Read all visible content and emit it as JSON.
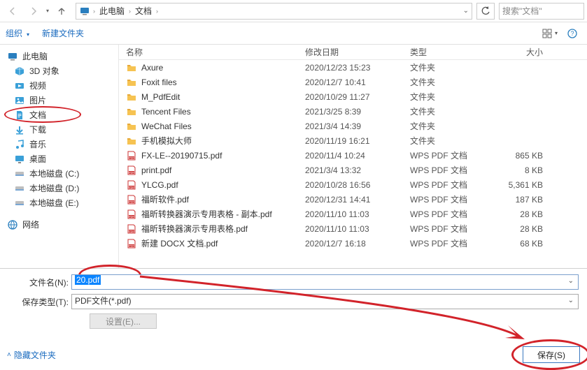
{
  "nav": {
    "back_icon": "←",
    "fwd_icon": "→"
  },
  "breadcrumb": {
    "root": "此电脑",
    "folder": "文档"
  },
  "search": {
    "placeholder": "搜索\"文档\""
  },
  "row2": {
    "organize": "组织",
    "newfolder": "新建文件夹"
  },
  "sidebar": {
    "this_pc": "此电脑",
    "items": [
      {
        "label": "3D 对象",
        "icon": "3d",
        "color": "#2aa7d8"
      },
      {
        "label": "视频",
        "icon": "video",
        "color": "#2aa7d8"
      },
      {
        "label": "图片",
        "icon": "pic",
        "color": "#2aa7d8"
      },
      {
        "label": "文档",
        "icon": "doc",
        "color": "#2aa7d8",
        "selected": true
      },
      {
        "label": "下载",
        "icon": "down",
        "color": "#2aa7d8"
      },
      {
        "label": "音乐",
        "icon": "music",
        "color": "#2aa7d8"
      },
      {
        "label": "桌面",
        "icon": "desk",
        "color": "#2aa7d8"
      },
      {
        "label": "本地磁盘 (C:)",
        "icon": "disk",
        "color": "#888"
      },
      {
        "label": "本地磁盘 (D:)",
        "icon": "disk",
        "color": "#888"
      },
      {
        "label": "本地磁盘 (E:)",
        "icon": "disk",
        "color": "#888"
      }
    ],
    "network": "网络"
  },
  "columns": {
    "name": "名称",
    "date": "修改日期",
    "type": "类型",
    "size": "大小"
  },
  "files": [
    {
      "name": "Axure",
      "date": "2020/12/23 15:23",
      "type": "文件夹",
      "size": "",
      "icon": "folder"
    },
    {
      "name": "Foxit files",
      "date": "2020/12/7 10:41",
      "type": "文件夹",
      "size": "",
      "icon": "folder"
    },
    {
      "name": "M_PdfEdit",
      "date": "2020/10/29 11:27",
      "type": "文件夹",
      "size": "",
      "icon": "folder"
    },
    {
      "name": "Tencent Files",
      "date": "2021/3/25 8:39",
      "type": "文件夹",
      "size": "",
      "icon": "folder"
    },
    {
      "name": "WeChat Files",
      "date": "2021/3/4 14:39",
      "type": "文件夹",
      "size": "",
      "icon": "folder"
    },
    {
      "name": "手机模拟大师",
      "date": "2020/11/19 16:21",
      "type": "文件夹",
      "size": "",
      "icon": "folder"
    },
    {
      "name": "FX-LE--20190715.pdf",
      "date": "2020/11/4 10:24",
      "type": "WPS PDF 文档",
      "size": "865 KB",
      "icon": "pdf"
    },
    {
      "name": "print.pdf",
      "date": "2021/3/4 13:32",
      "type": "WPS PDF 文档",
      "size": "8 KB",
      "icon": "pdf"
    },
    {
      "name": "YLCG.pdf",
      "date": "2020/10/28 16:56",
      "type": "WPS PDF 文档",
      "size": "5,361 KB",
      "icon": "pdf"
    },
    {
      "name": "福昕软件.pdf",
      "date": "2020/12/31 14:41",
      "type": "WPS PDF 文档",
      "size": "187 KB",
      "icon": "pdf"
    },
    {
      "name": "福昕转换器演示专用表格 - 副本.pdf",
      "date": "2020/11/10 11:03",
      "type": "WPS PDF 文档",
      "size": "28 KB",
      "icon": "pdf"
    },
    {
      "name": "福昕转换器演示专用表格.pdf",
      "date": "2020/11/10 11:03",
      "type": "WPS PDF 文档",
      "size": "28 KB",
      "icon": "pdf"
    },
    {
      "name": "新建 DOCX 文档.pdf",
      "date": "2020/12/7 16:18",
      "type": "WPS PDF 文档",
      "size": "68 KB",
      "icon": "pdf"
    }
  ],
  "bottom": {
    "filename_label": "文件名(N):",
    "filename_value": "20.pdf",
    "type_label": "保存类型(T):",
    "type_value": "PDF文件(*.pdf)",
    "settings": "设置(E)..."
  },
  "footer": {
    "hide": "隐藏文件夹",
    "save": "保存(S)"
  }
}
